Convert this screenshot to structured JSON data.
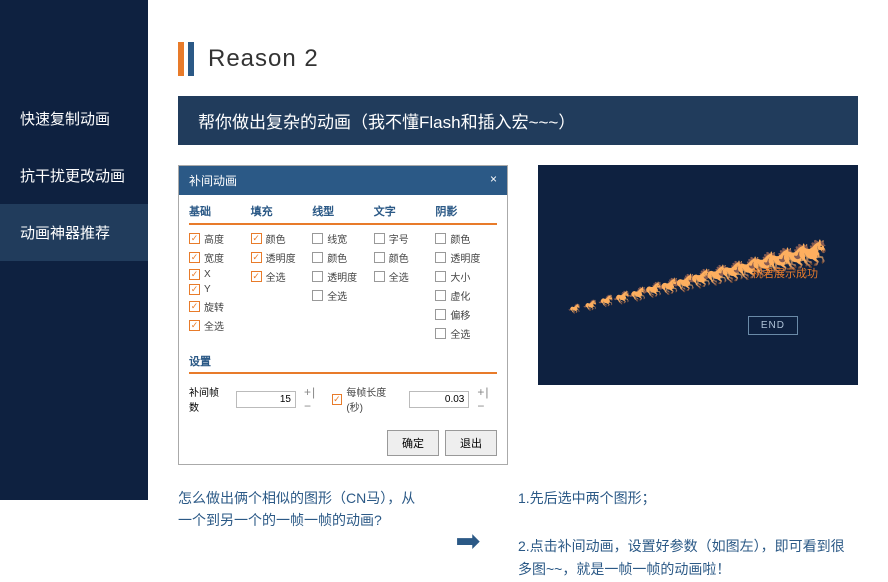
{
  "sidebar": {
    "items": [
      {
        "label": "快速复制动画"
      },
      {
        "label": "抗干扰更改动画"
      },
      {
        "label": "动画神器推荐",
        "active": true
      }
    ]
  },
  "title": "Reason 2",
  "subtitle": "帮你做出复杂的动画（我不懂Flash和插入宏~~~）",
  "dialog": {
    "title": "补间动画",
    "close": "×",
    "columns": [
      {
        "head": "基础",
        "items": [
          {
            "t": "高度",
            "c": 1
          },
          {
            "t": "宽度",
            "c": 1
          },
          {
            "t": "X",
            "c": 1
          },
          {
            "t": "Y",
            "c": 1
          },
          {
            "t": "旋转",
            "c": 1
          },
          {
            "t": "全选",
            "c": 1
          }
        ]
      },
      {
        "head": "填充",
        "items": [
          {
            "t": "颜色",
            "c": 1
          },
          {
            "t": "透明度",
            "c": 1
          },
          {
            "t": "全选",
            "c": 1
          }
        ]
      },
      {
        "head": "线型",
        "items": [
          {
            "t": "线宽",
            "c": 0
          },
          {
            "t": "颜色",
            "c": 0
          },
          {
            "t": "透明度",
            "c": 0
          },
          {
            "t": "全选",
            "c": 0
          }
        ]
      },
      {
        "head": "文字",
        "items": [
          {
            "t": "字号",
            "c": 0
          },
          {
            "t": "颜色",
            "c": 0
          },
          {
            "t": "全选",
            "c": 0
          }
        ]
      },
      {
        "head": "阴影",
        "items": [
          {
            "t": "颜色",
            "c": 0
          },
          {
            "t": "透明度",
            "c": 0
          },
          {
            "t": "大小",
            "c": 0
          },
          {
            "t": "虚化",
            "c": 0
          },
          {
            "t": "偏移",
            "c": 0
          },
          {
            "t": "全选",
            "c": 0
          }
        ]
      }
    ],
    "settings_head": "设置",
    "frames_label": "补间帧数",
    "frames_value": "15",
    "duration_label": "每帧长度(秒)",
    "duration_checked": 1,
    "duration_value": "0.03",
    "ok": "确定",
    "cancel": "退出"
  },
  "preview": {
    "text": "祝君展示成功",
    "end": "END"
  },
  "question": "怎么做出俩个相似的图形（CN马），从一个到另一个的一帧一帧的动画?",
  "answer_1": "1.先后选中两个图形；",
  "answer_2": "2.点击补间动画，设置好参数（如图左），即可看到很多图~~，就是一帧一帧的动画啦！"
}
